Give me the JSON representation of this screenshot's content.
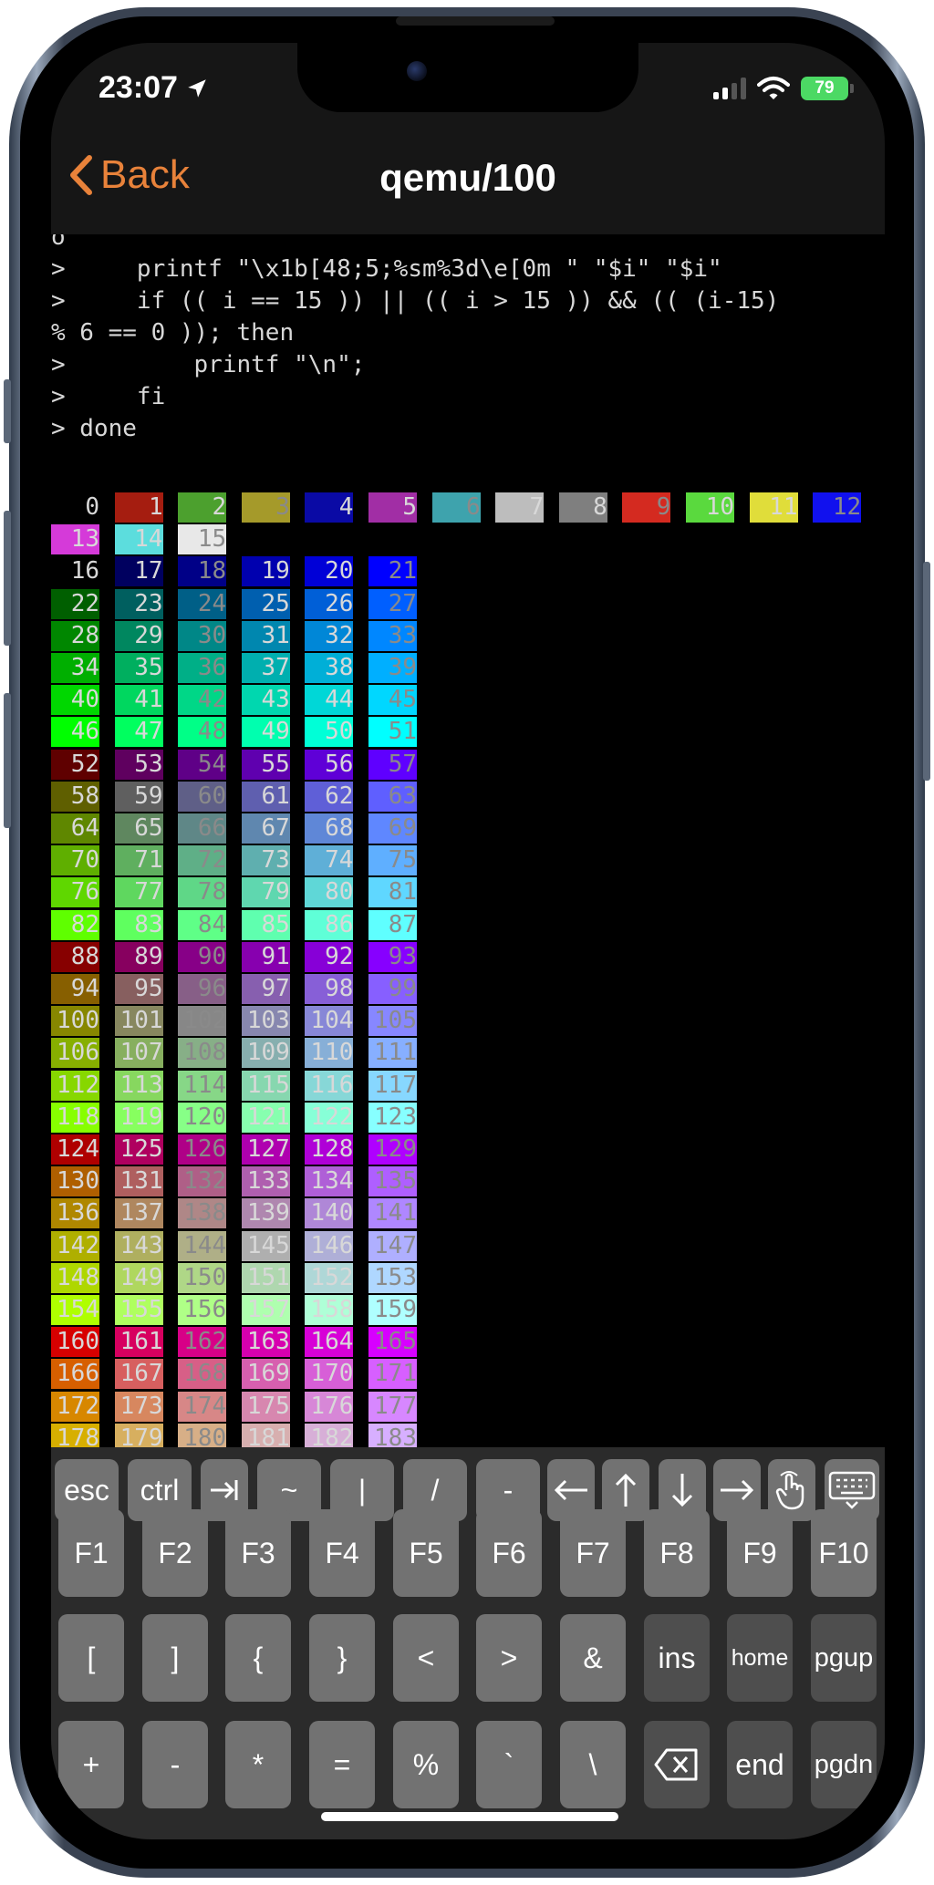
{
  "status_bar": {
    "time": "23:07",
    "battery": "79"
  },
  "nav": {
    "back_label": "Back",
    "title": "qemu/100"
  },
  "terminal": {
    "lines": [
      "o",
      ">     printf \"\\x1b[48;5;%sm%3d\\e[0m \" \"$i\" \"$i\"",
      ">     if (( i == 15 )) || (( i > 15 )) && (( (i-15)",
      "% 6 == 0 )); then",
      ">         printf \"\\n\";",
      ">     fi",
      "> done"
    ],
    "color_rows": [
      [
        0,
        1,
        2,
        3,
        4,
        5,
        6,
        7,
        8,
        9,
        10,
        11,
        12
      ],
      [
        13,
        14,
        15
      ],
      [
        16,
        17,
        18,
        19,
        20,
        21
      ],
      [
        22,
        23,
        24,
        25,
        26,
        27
      ],
      [
        28,
        29,
        30,
        31,
        32,
        33
      ],
      [
        34,
        35,
        36,
        37,
        38,
        39
      ],
      [
        40,
        41,
        42,
        43,
        44,
        45
      ],
      [
        46,
        47,
        48,
        49,
        50,
        51
      ],
      [
        52,
        53,
        54,
        55,
        56,
        57
      ],
      [
        58,
        59,
        60,
        61,
        62,
        63
      ],
      [
        64,
        65,
        66,
        67,
        68,
        69
      ],
      [
        70,
        71,
        72,
        73,
        74,
        75
      ],
      [
        76,
        77,
        78,
        79,
        80,
        81
      ],
      [
        82,
        83,
        84,
        85,
        86,
        87
      ],
      [
        88,
        89,
        90,
        91,
        92,
        93
      ],
      [
        94,
        95,
        96,
        97,
        98,
        99
      ],
      [
        100,
        101,
        102,
        103,
        104,
        105
      ],
      [
        106,
        107,
        108,
        109,
        110,
        111
      ],
      [
        112,
        113,
        114,
        115,
        116,
        117
      ],
      [
        118,
        119,
        120,
        121,
        122,
        123
      ],
      [
        124,
        125,
        126,
        127,
        128,
        129
      ],
      [
        130,
        131,
        132,
        133,
        134,
        135
      ],
      [
        136,
        137,
        138,
        139,
        140,
        141
      ],
      [
        142,
        143,
        144,
        145,
        146,
        147
      ],
      [
        148,
        149,
        150,
        151,
        152,
        153
      ],
      [
        154,
        155,
        156,
        157,
        158,
        159
      ],
      [
        160,
        161,
        162,
        163,
        164,
        165
      ],
      [
        166,
        167,
        168,
        169,
        170,
        171
      ],
      [
        172,
        173,
        174,
        175,
        176,
        177
      ],
      [
        178,
        179,
        180,
        181,
        182,
        183
      ]
    ]
  },
  "keyboard": {
    "toolbar": [
      {
        "label": "esc",
        "name": "esc-key"
      },
      {
        "label": "ctrl",
        "name": "ctrl-key"
      },
      {
        "label": "⇥",
        "name": "tab-key",
        "icon": "tab-icon"
      },
      {
        "label": "~",
        "name": "tilde-key"
      },
      {
        "label": "|",
        "name": "pipe-key"
      },
      {
        "label": "/",
        "name": "slash-key"
      },
      {
        "label": "-",
        "name": "minus-key"
      },
      {
        "label": "←",
        "name": "arrow-left-key",
        "icon": "arrow-left-icon"
      },
      {
        "label": "↑",
        "name": "arrow-up-key",
        "icon": "arrow-up-icon"
      },
      {
        "label": "↓",
        "name": "arrow-down-key",
        "icon": "arrow-down-icon"
      },
      {
        "label": "→",
        "name": "arrow-right-key",
        "icon": "arrow-right-icon"
      },
      {
        "label": "",
        "name": "touch-mode-key",
        "icon": "hand-pointer-icon"
      },
      {
        "label": "",
        "name": "keyboard-toggle-key",
        "icon": "keyboard-icon"
      }
    ],
    "row1": [
      "F1",
      "F2",
      "F3",
      "F4",
      "F5",
      "F6",
      "F7",
      "F8",
      "F9",
      "F10"
    ],
    "row2": [
      "[",
      "]",
      "{",
      "}",
      "<",
      ">",
      "&",
      "ins",
      "home",
      "pgup"
    ],
    "row3": [
      "+",
      "-",
      "*",
      "=",
      "%",
      "`",
      "\\",
      "",
      "end",
      "pgdn"
    ],
    "delete_icon": "delete-icon"
  }
}
